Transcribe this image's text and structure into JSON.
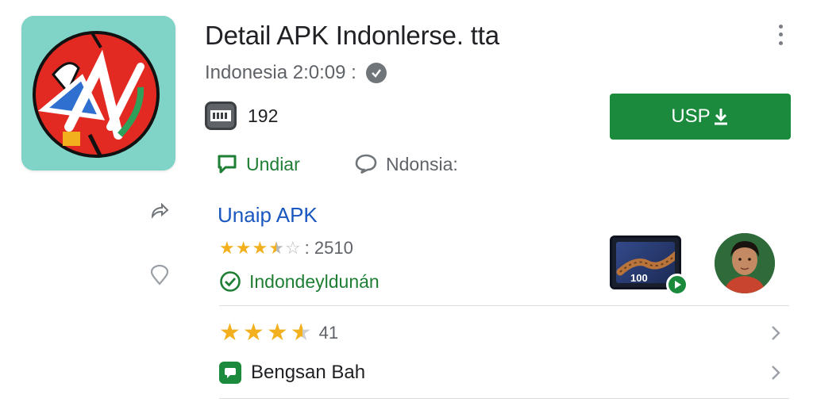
{
  "app": {
    "title": "Detail APK Indonlerse. tta",
    "subtitle": "Indonesia 2:0:09 :",
    "count": "192",
    "install_label": "USP",
    "tag_primary": "Undiar",
    "tag_secondary": "Ndonsia:"
  },
  "section": {
    "title": "Unaip APK",
    "rating_value": 3.5,
    "rating_text": ": 2510",
    "check_text": "Indondeyldunán",
    "thumbnail_text": "100"
  },
  "rows": {
    "rating_value": 3.5,
    "rating_count": "41",
    "chat_label": "Bengsan Bah"
  },
  "icons": {
    "menu": "more-vertical-icon",
    "verified": "verified-icon",
    "film": "film-strip-icon",
    "download": "download-icon",
    "chat_outline_green": "chat-bubble-icon",
    "chat_outline_gray": "chat-bubble-icon",
    "share": "share-icon",
    "location": "location-pin-icon",
    "check": "check-circle-icon",
    "play": "play-icon",
    "chevron": "chevron-right-icon",
    "chat_filled": "chat-square-icon"
  },
  "colors": {
    "install_green": "#1c8a3c",
    "link_blue": "#1a57c0",
    "star_gold": "#f2b01e",
    "tag_green": "#1e7e34",
    "icon_bg_teal": "#7fd3c7",
    "icon_circle_red": "#e32a22"
  }
}
